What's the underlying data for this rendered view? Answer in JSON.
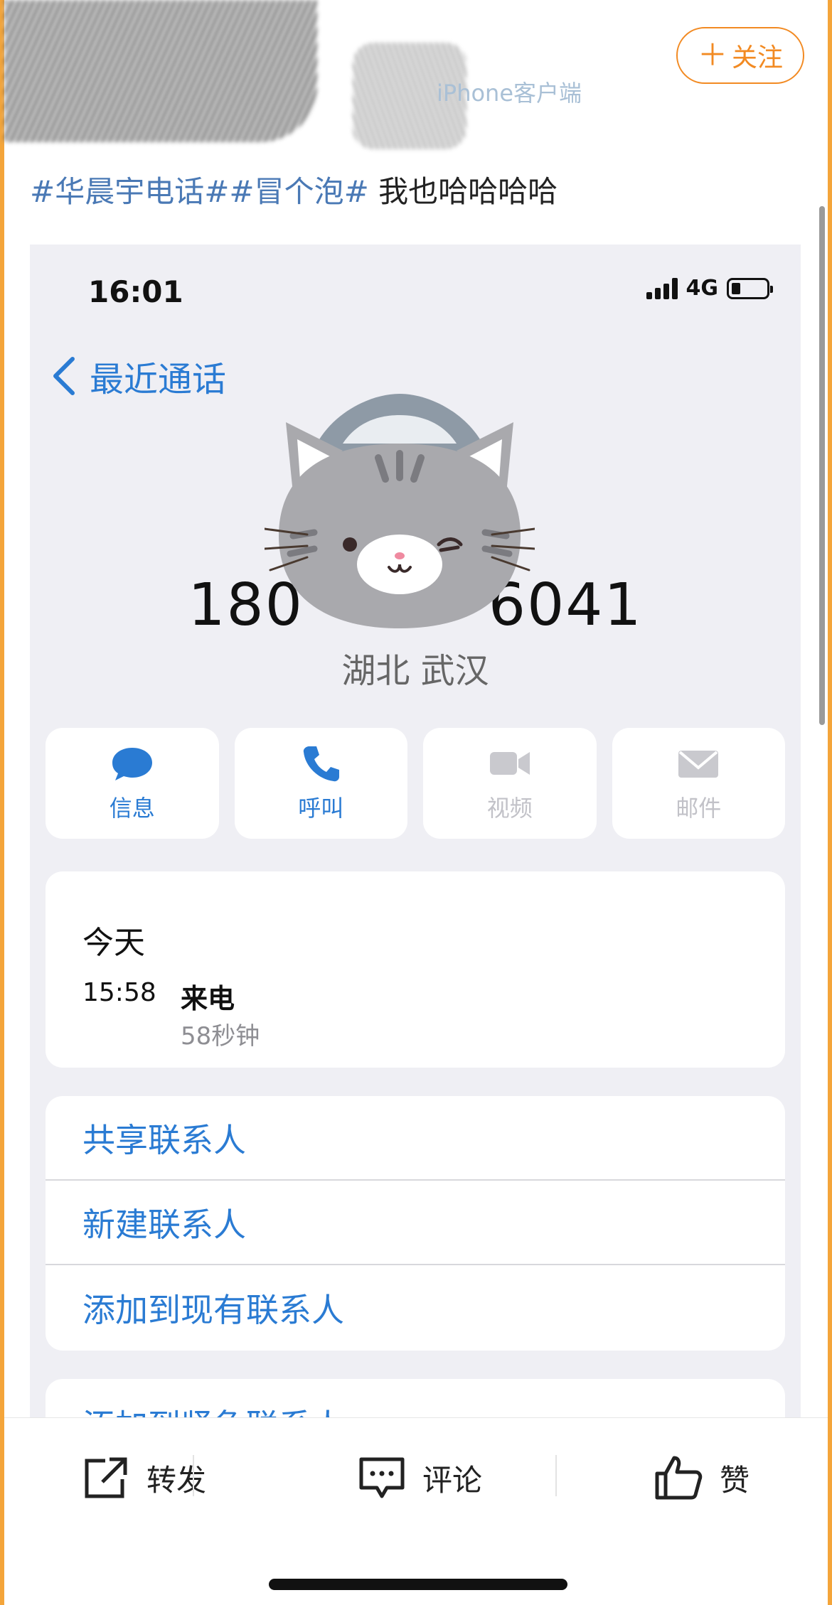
{
  "header": {
    "source_label": "iPhone客户端",
    "follow_label": "关注",
    "follow_plus": "＋"
  },
  "post": {
    "tag1": "#华晨宇电话#",
    "tag2": "#冒个泡#",
    "text": " 我也哈哈哈哈"
  },
  "screenshot": {
    "status_time": "16:01",
    "network": "4G",
    "back_label": "最近通话",
    "phone_prefix": "180",
    "phone_suffix": "6041",
    "location": "湖北 武汉",
    "actions": [
      {
        "label": "信息",
        "icon": "message-icon",
        "enabled": true
      },
      {
        "label": "呼叫",
        "icon": "phone-icon",
        "enabled": true
      },
      {
        "label": "视频",
        "icon": "video-icon",
        "enabled": false
      },
      {
        "label": "邮件",
        "icon": "mail-icon",
        "enabled": false
      }
    ],
    "history": {
      "day": "今天",
      "time": "15:58",
      "type": "来电",
      "duration": "58秒钟"
    },
    "contact_options": [
      "共享联系人",
      "新建联系人",
      "添加到现有联系人"
    ],
    "emergency_option": "添加到紧急联系人"
  },
  "bottom_bar": {
    "forward": "转发",
    "comment": "评论",
    "like": "赞"
  },
  "colors": {
    "accent_orange": "#f28a22",
    "ios_blue": "#2a7bd3",
    "tag_blue": "#4a79b5"
  }
}
